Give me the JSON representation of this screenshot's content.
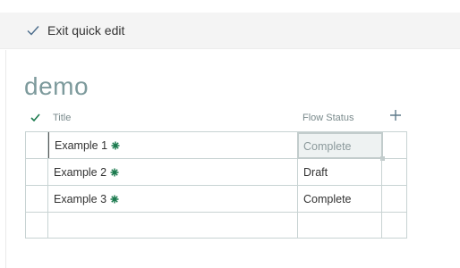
{
  "toolbar": {
    "exit_label": "Exit quick edit"
  },
  "page": {
    "title": "demo"
  },
  "grid": {
    "columns": {
      "title": "Title",
      "status": "Flow Status"
    },
    "rows": [
      {
        "title": "Example 1",
        "status": "Complete",
        "is_new": true
      },
      {
        "title": "Example 2",
        "status": "Draft",
        "is_new": true
      },
      {
        "title": "Example 3",
        "status": "Complete",
        "is_new": true
      },
      {
        "title": "",
        "status": ""
      }
    ]
  },
  "icons": {
    "exit": "checkmark-icon",
    "select_all": "checkmark-icon",
    "add_column": "plus-icon",
    "new_item": "new-item-icon"
  },
  "colors": {
    "accent": "#1b7a4e",
    "title": "#7d9a9c",
    "grid_border": "#c8d3d3",
    "selected_cell": "#eef2f2"
  }
}
